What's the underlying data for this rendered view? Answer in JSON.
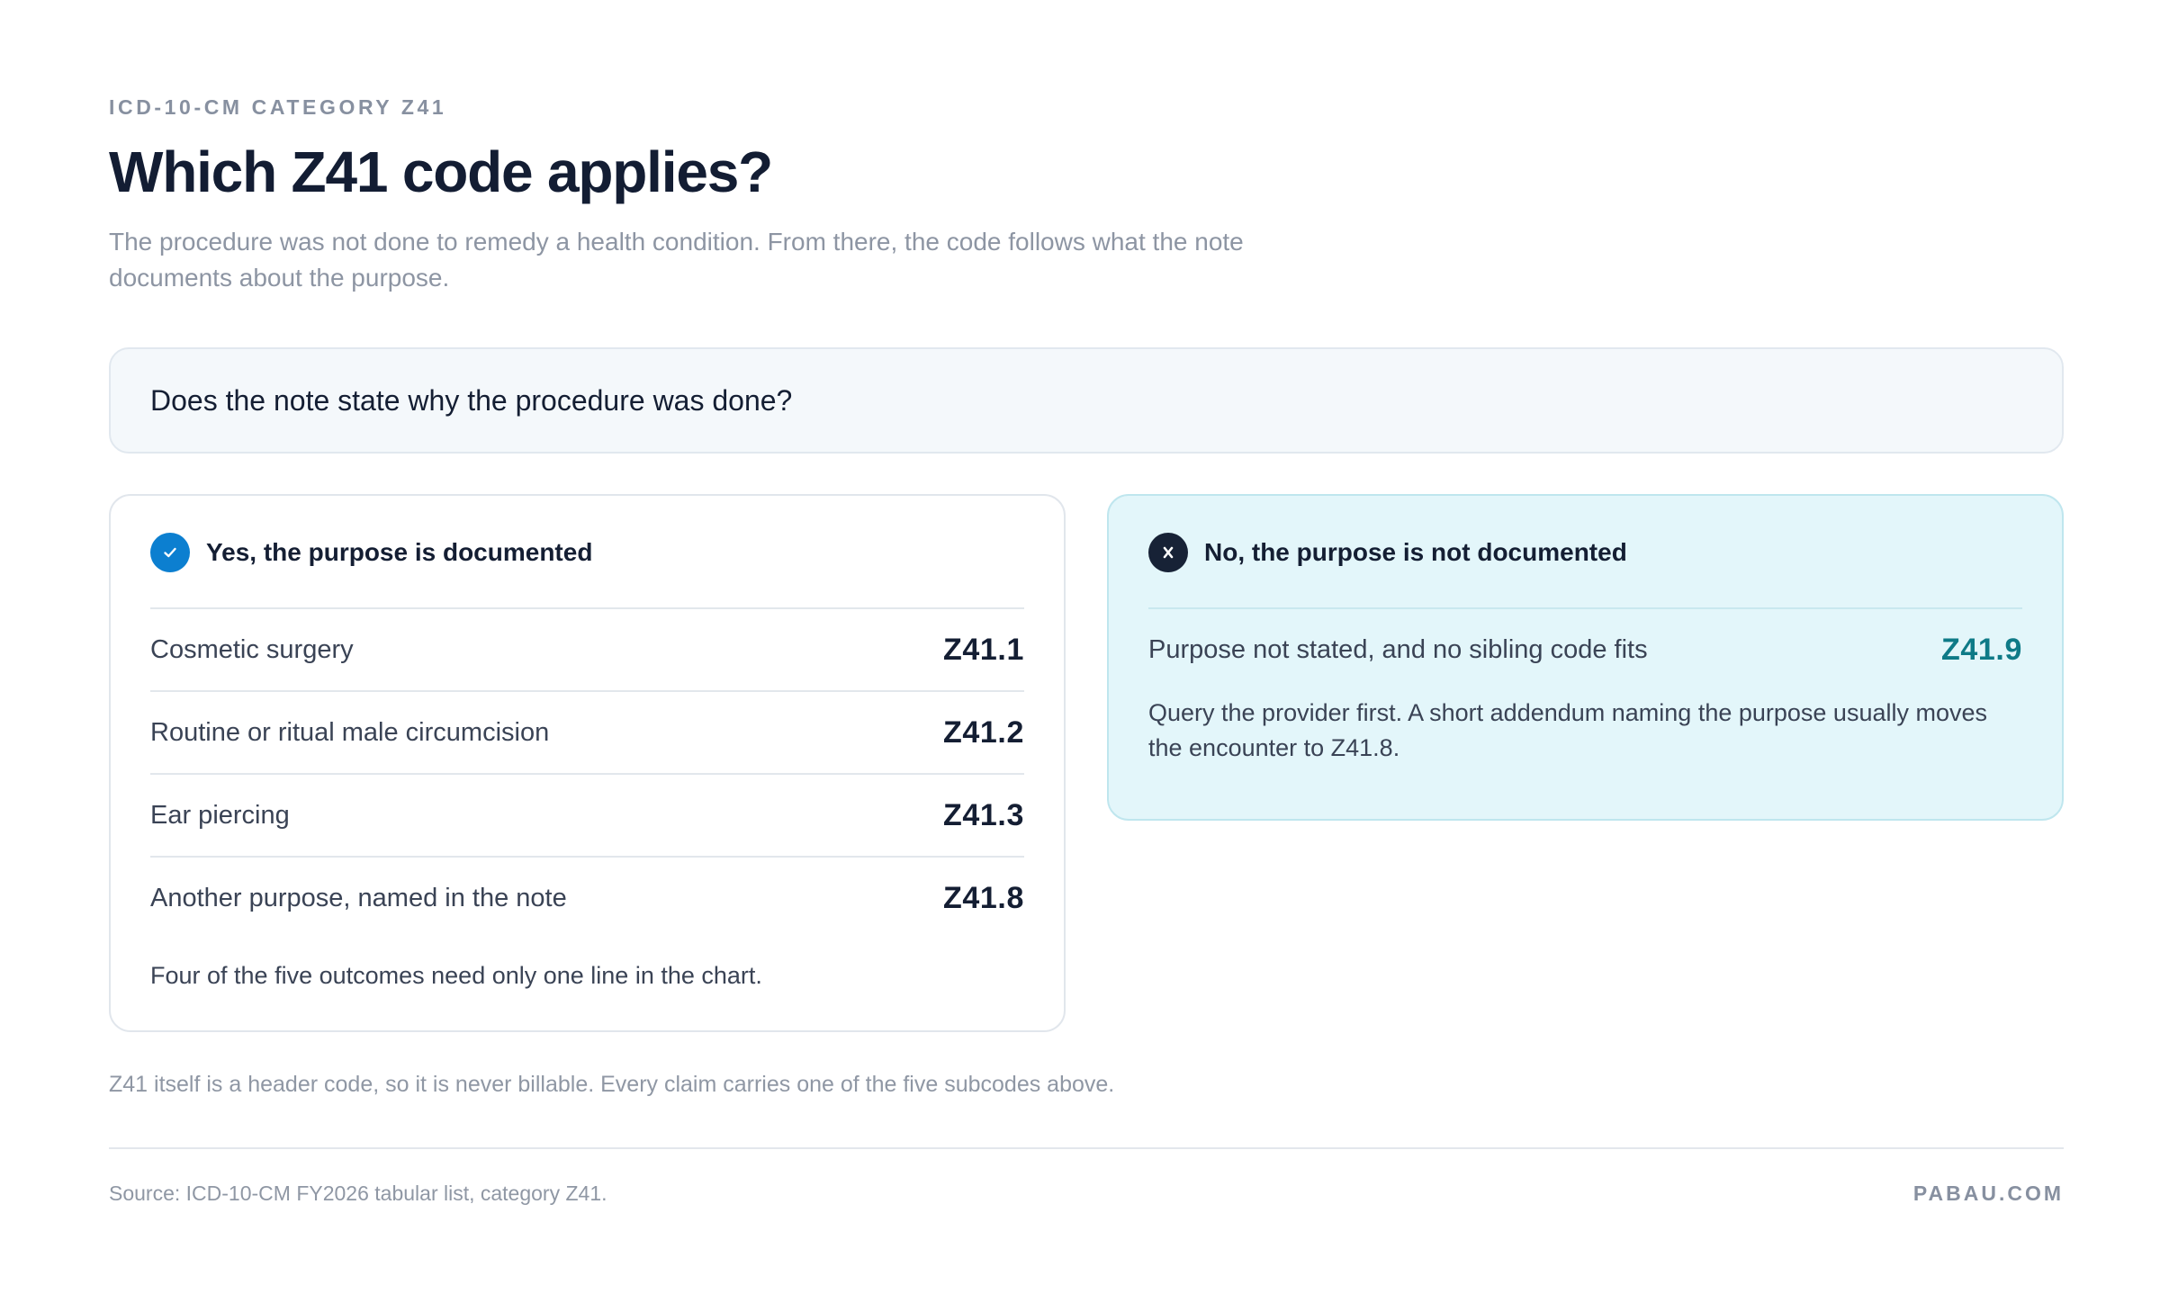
{
  "header": {
    "eyebrow": "ICD-10-CM CATEGORY Z41",
    "title": "Which Z41 code applies?",
    "subtitle": "The procedure was not done to remedy a health condition. From there, the code follows what the note documents about the purpose."
  },
  "question": {
    "text": "Does the note state why the procedure was done?"
  },
  "yes_panel": {
    "icon": "checkmark-icon",
    "label": "Yes, the purpose is documented",
    "accent_color": "#0c7fd0",
    "rows": [
      {
        "label": "Cosmetic surgery",
        "code": "Z41.1"
      },
      {
        "label": "Routine or ritual male circumcision",
        "code": "Z41.2"
      },
      {
        "label": "Ear piercing",
        "code": "Z41.3"
      },
      {
        "label": "Another purpose, named in the note",
        "code": "Z41.8"
      }
    ],
    "note": "Four of the five outcomes need only one line in the chart."
  },
  "no_panel": {
    "icon": "cross-icon",
    "label": "No, the purpose is not documented",
    "accent_color": "#0e7a87",
    "row": {
      "label": "Purpose not stated, and no sibling code fits",
      "code": "Z41.9"
    },
    "note": "Query the provider first. A short addendum naming the purpose usually moves the encounter to Z41.8."
  },
  "footer": {
    "footnote": "Z41 itself is a header code, so it is never billable. Every claim carries one of the five subcodes above.",
    "source": "Source: ICD-10-CM FY2026 tabular list, category Z41.",
    "brand": "PABAU.COM"
  }
}
